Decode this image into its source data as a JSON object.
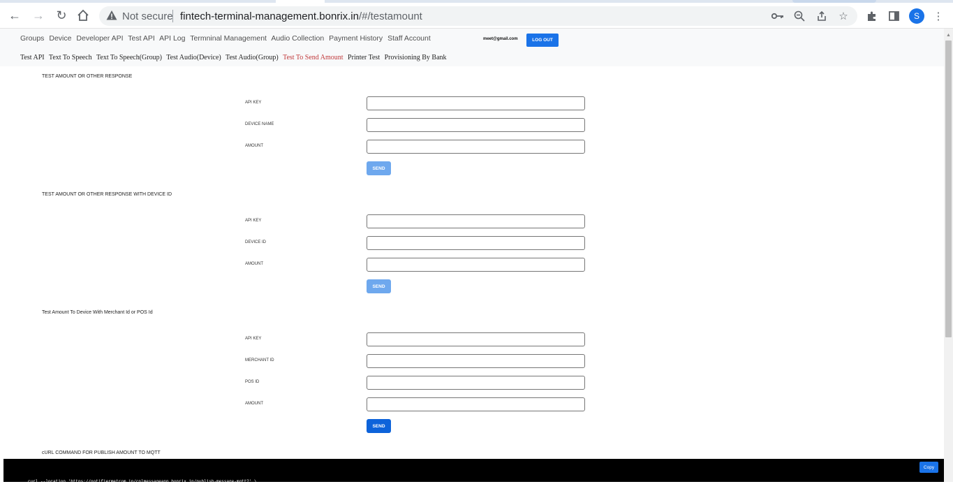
{
  "browser": {
    "not_secure": "Not secure",
    "url_host": "fintech-terminal-management.bonrix.in",
    "url_path": "/#/testamount",
    "profile_initial": "S"
  },
  "header": {
    "menu": [
      "Groups",
      "Device",
      "Developer API",
      "Test API",
      "API Log",
      "Termninal Management",
      "Audio Collection",
      "Payment History",
      "Staff Account"
    ],
    "email": "meet@gmail.com",
    "logout_label": "LOG OUT",
    "submenu": [
      "Test API",
      "Text To Speech",
      "Text To Speech(Group)",
      "Test Audio(Device)",
      "Test Audio(Group)",
      "Test To Send Amount",
      "Printer Test",
      "Provisioning By Bank"
    ],
    "active_submenu": "Test To Send Amount"
  },
  "sections": {
    "s1": {
      "title": "TEST AMOUNT OR OTHER RESPONSE",
      "labels": [
        "API KEY",
        "DEVICE NAME",
        "AMOUNT"
      ],
      "send_label": "SEND"
    },
    "s2": {
      "title": "TEST AMOUNT OR OTHER RESPONSE WITH DEVICE ID",
      "labels": [
        "API KEY",
        "DEVICE ID",
        "AMOUNT"
      ],
      "send_label": "SEND"
    },
    "s3": {
      "title": "Test Amount To Device With Merchant Id or POS Id",
      "labels": [
        "API KEY",
        "MERCHANT ID",
        "POS ID",
        "AMOUNT"
      ],
      "send_label": "SEND"
    }
  },
  "curl": {
    "title": "cURL COMMAND FOR PUBLISH AMOUNT TO MQTT",
    "copy_label": "Copy",
    "command": "curl --location 'https://notifiermetrom.in/cplmessageapp.bonrix.in/publish-message-mqtt?' \\"
  },
  "colors": {
    "primary": "#1a73e8",
    "send_disabled": "#6ea8ee",
    "send_enabled": "#0d63da",
    "active_link": "#c0393b"
  }
}
